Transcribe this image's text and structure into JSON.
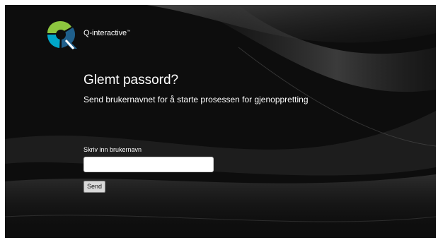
{
  "brand": {
    "name": "Q-interactive",
    "trademark": "™",
    "logo_icon": "q-logo-icon",
    "logo_colors": [
      "#8dc63f",
      "#00a6c8",
      "#1f5f8b",
      "#ffffff"
    ]
  },
  "page": {
    "title": "Glemt passord?",
    "subtitle": "Send brukernavnet for å starte prosessen for gjenoppretting"
  },
  "form": {
    "username_label": "Skriv inn brukernavn",
    "username_value": "",
    "send_label": "Send"
  },
  "colors": {
    "background": "#0d0d0d",
    "text": "#ffffff"
  }
}
